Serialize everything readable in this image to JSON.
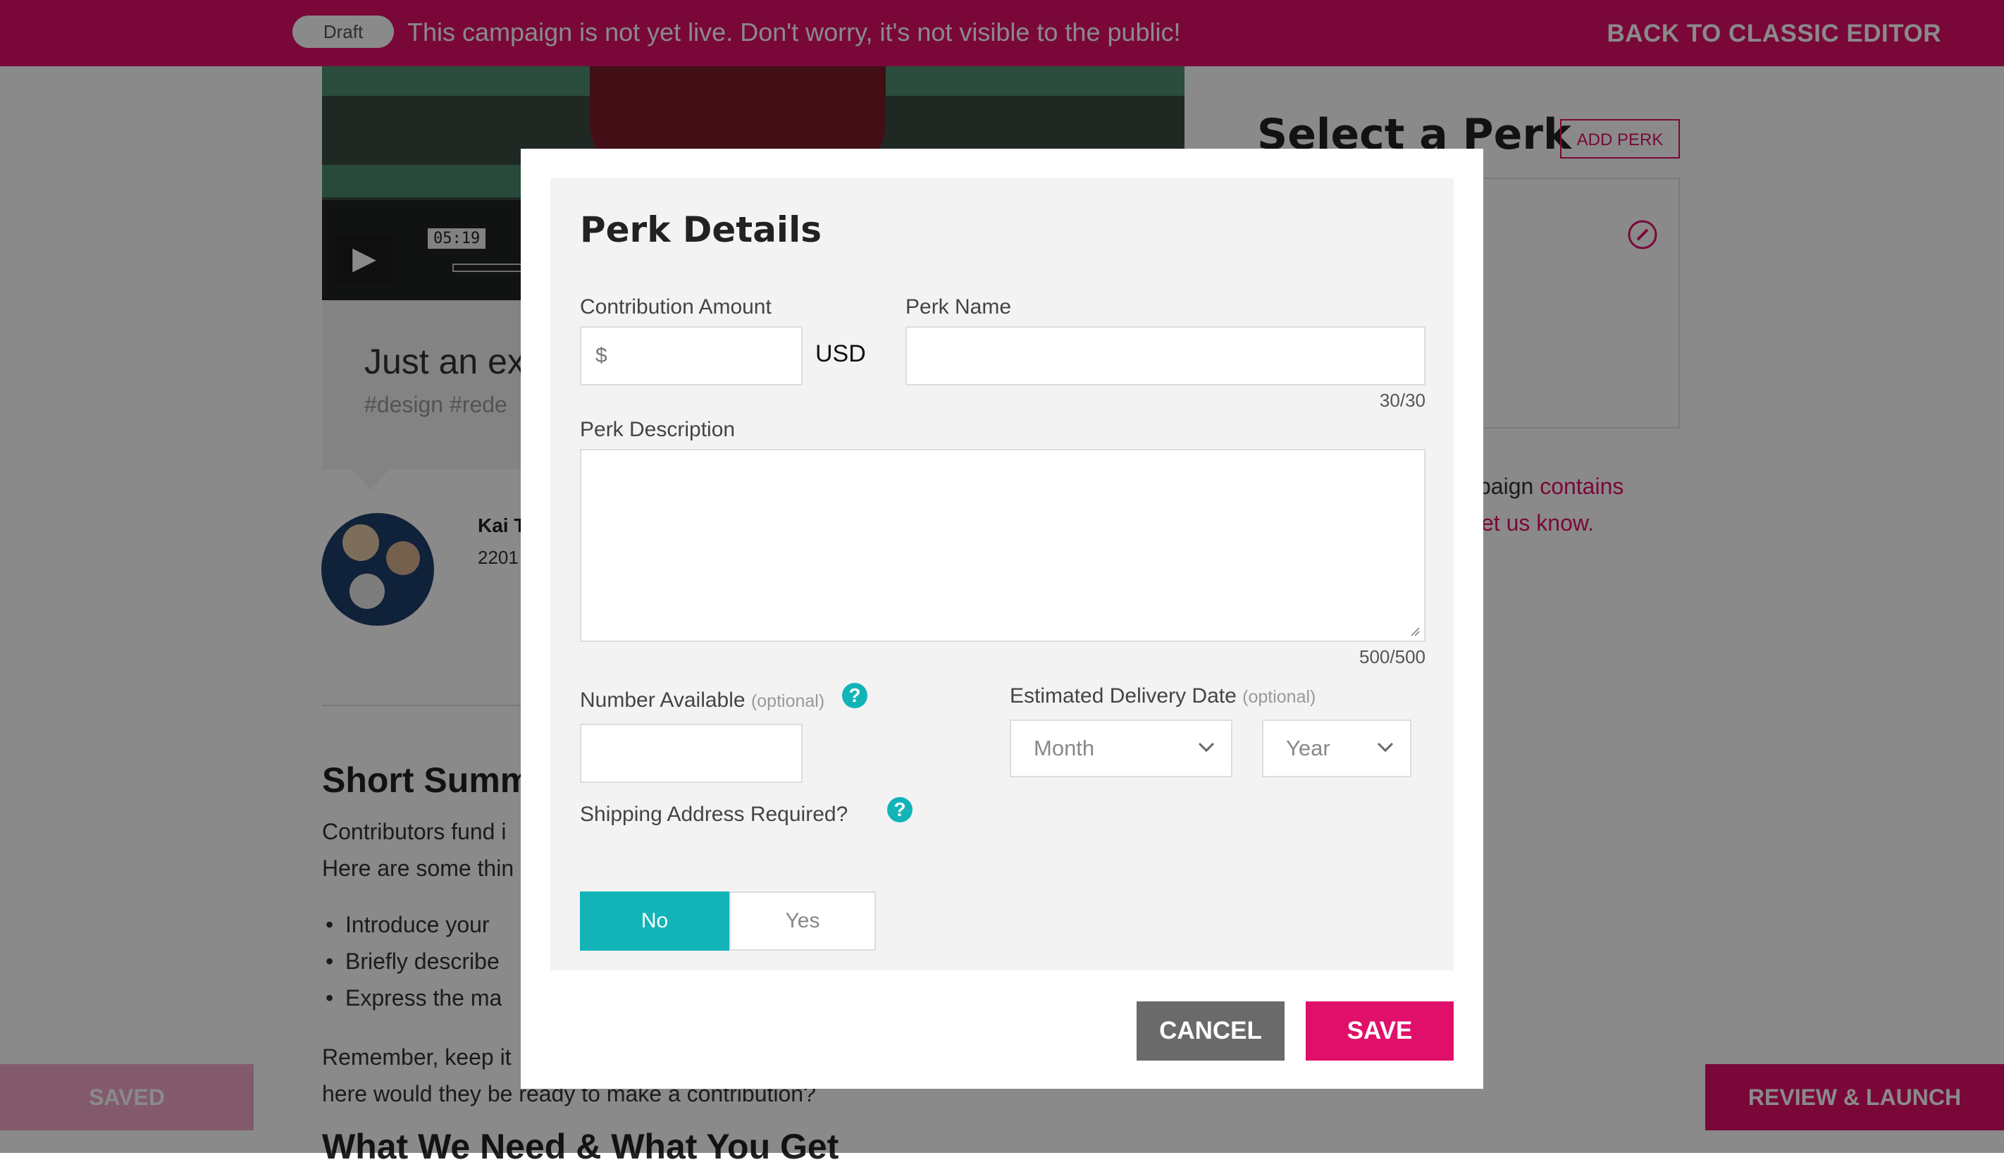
{
  "banner": {
    "draft_badge": "Draft",
    "message": "This campaign is not yet live. Don't worry, it's not visible to the public!",
    "back_to_classic": "BACK TO CLASSIC EDITOR"
  },
  "video": {
    "time": "05:19",
    "play_icon": "play-icon"
  },
  "campaign_card": {
    "title": "Just an ex",
    "tags": "#design  #rede"
  },
  "author": {
    "name": "Kai T",
    "number": "2201"
  },
  "story": {
    "heading": "Short Summ",
    "line1": "Contributors fund i",
    "line2": "Here are some thin",
    "bullets": [
      "Introduce your",
      "Briefly describe",
      "Express the ma"
    ],
    "remember_line1": "Remember, keep it",
    "remember_line2": "here would they be ready to make a contribution?",
    "next_heading": "What We Need & What You Get"
  },
  "perks_sidebar": {
    "heading": "Select a Perk",
    "add_perk": "ADD PERK",
    "edit_icon": "pencil-icon",
    "note_line1_plain": "paign ",
    "note_line1_link": "contains",
    "note_line2_link": "et us know."
  },
  "footer": {
    "saved": "SAVED",
    "review_launch": "REVIEW & LAUNCH"
  },
  "modal": {
    "title": "Perk Details",
    "contribution_label": "Contribution Amount",
    "contribution_placeholder": "$",
    "currency": "USD",
    "perk_name_label": "Perk Name",
    "perk_name_value": "",
    "perk_name_counter": "30/30",
    "description_label": "Perk Description",
    "description_value": "",
    "description_counter": "500/500",
    "number_available_label": "Number Available",
    "optional": "(optional)",
    "delivery_label": "Estimated Delivery Date",
    "month": "Month",
    "year": "Year",
    "shipping_label": "Shipping Address Required?",
    "help_glyph": "?",
    "no": "No",
    "yes": "Yes",
    "shipping_selected": "No",
    "cancel": "CANCEL",
    "save": "SAVE"
  },
  "colors": {
    "brand": "#e0106a",
    "teal": "#12b4b8",
    "cancel_gray": "#6a6a6a"
  }
}
